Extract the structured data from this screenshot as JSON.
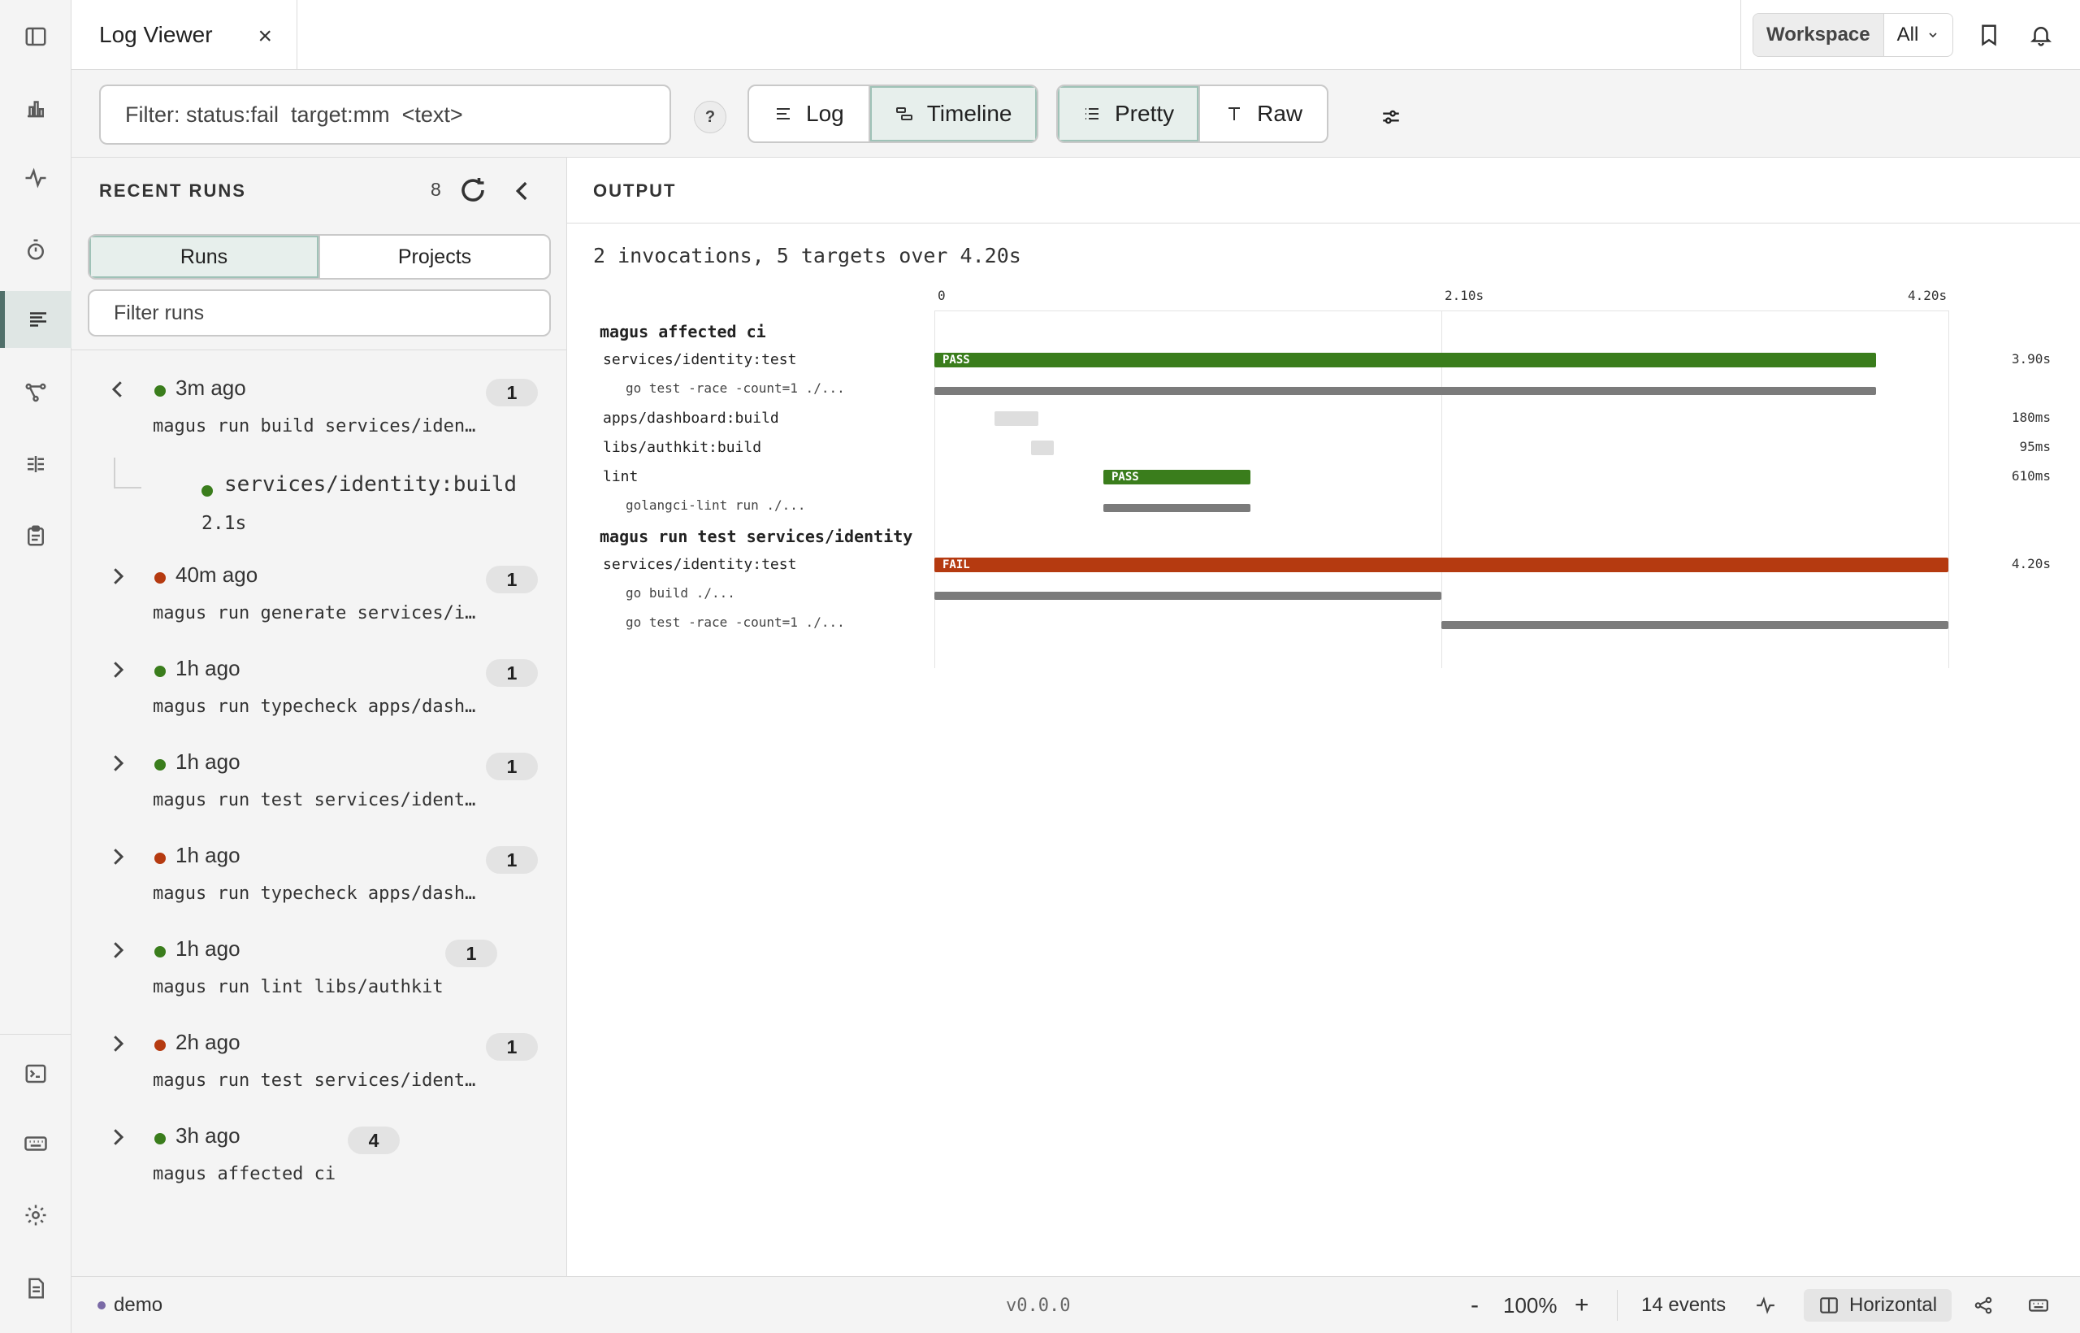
{
  "rail": {
    "icons": [
      "sidebar-toggle-icon",
      "bar-chart-icon",
      "pulse-icon",
      "stopwatch-icon",
      "log-lines-icon",
      "graph-icon",
      "split-columns-icon",
      "clipboard-icon",
      "terminal-icon",
      "keyboard-icon",
      "gear-icon",
      "document-icon"
    ],
    "active": "log-lines-icon"
  },
  "topbar": {
    "tab_title": "Log Viewer",
    "tab_close": "×",
    "workspace_label": "Workspace",
    "workspace_value": "All"
  },
  "toolbar": {
    "filter_value": "Filter: status:fail  target:mm  <text>",
    "help": "?",
    "view_modes": [
      {
        "label": "Log",
        "active": false
      },
      {
        "label": "Timeline",
        "active": true
      }
    ],
    "format_modes": [
      {
        "label": "Pretty",
        "active": true
      },
      {
        "label": "Raw",
        "active": false
      }
    ]
  },
  "sidebar": {
    "title": "RECENT RUNS",
    "count": "8",
    "tabs": [
      {
        "label": "Runs",
        "active": true
      },
      {
        "label": "Projects",
        "active": false
      }
    ],
    "filter_placeholder": "Filter runs",
    "runs": [
      {
        "time": "3m ago",
        "status": "pass",
        "cmd": "magus run build services/iden…",
        "badge": "1",
        "expanded": true,
        "children": [
          {
            "name": "services/identity:build",
            "duration": "2.1s",
            "status": "pass"
          }
        ]
      },
      {
        "time": "40m ago",
        "status": "fail",
        "cmd": "magus run generate services/i…",
        "badge": "1"
      },
      {
        "time": "1h ago",
        "status": "pass",
        "cmd": "magus run typecheck apps/dash…",
        "badge": "1"
      },
      {
        "time": "1h ago",
        "status": "pass",
        "cmd": "magus run test services/ident…",
        "badge": "1"
      },
      {
        "time": "1h ago",
        "status": "fail",
        "cmd": "magus run typecheck apps/dash…",
        "badge": "1"
      },
      {
        "time": "1h ago",
        "status": "pass",
        "cmd": "magus run lint libs/authkit",
        "badge": "1"
      },
      {
        "time": "2h ago",
        "status": "fail",
        "cmd": "magus run test services/ident…",
        "badge": "1"
      },
      {
        "time": "3h ago",
        "status": "pass",
        "cmd": "magus affected ci",
        "badge": "4"
      }
    ]
  },
  "output": {
    "title": "OUTPUT",
    "summary": "2 invocations, 5 targets over 4.20s",
    "axis": {
      "min": 0,
      "max": 4.2,
      "ticks": [
        {
          "v": 0,
          "label": "0"
        },
        {
          "v": 2.1,
          "label": "2.10s"
        },
        {
          "v": 4.2,
          "label": "4.20s"
        }
      ]
    },
    "rows": [
      {
        "kind": "group",
        "label": "magus affected ci"
      },
      {
        "kind": "target",
        "label": "services/identity:test",
        "start": 0,
        "end": 3.9,
        "status": "pass",
        "bar_text": "PASS",
        "duration": "3.90s"
      },
      {
        "kind": "cmd",
        "label": "go test -race -count=1 ./...",
        "start": 0,
        "end": 3.9
      },
      {
        "kind": "target",
        "label": "apps/dashboard:build",
        "start": 0.25,
        "end": 0.43,
        "status": "cached",
        "bar_text": "",
        "duration": "180ms"
      },
      {
        "kind": "target",
        "label": "libs/authkit:build",
        "start": 0.4,
        "end": 0.495,
        "status": "cached",
        "bar_text": "",
        "duration": "95ms"
      },
      {
        "kind": "target",
        "label": "lint",
        "start": 0.7,
        "end": 1.31,
        "status": "pass",
        "bar_text": "PASS",
        "duration": "610ms"
      },
      {
        "kind": "cmd",
        "label": "golangci-lint run ./...",
        "start": 0.7,
        "end": 1.31
      },
      {
        "kind": "group",
        "label": "magus run test services/identity"
      },
      {
        "kind": "target",
        "label": "services/identity:test",
        "start": 0,
        "end": 4.2,
        "status": "fail",
        "bar_text": "FAIL",
        "duration": "4.20s"
      },
      {
        "kind": "cmd",
        "label": "go build ./...",
        "start": 0,
        "end": 2.1
      },
      {
        "kind": "cmd",
        "label": "go test -race -count=1 ./...",
        "start": 2.1,
        "end": 4.2
      }
    ]
  },
  "statusbar": {
    "env": "demo",
    "version": "v0.0.0",
    "zoom_out": "-",
    "zoom": "100%",
    "zoom_in": "+",
    "events": "14 events",
    "layout": "Horizontal"
  },
  "colors": {
    "pass": "#3a7d1c",
    "fail": "#b53a10",
    "cached": "#dedede",
    "cmd": "#7b7b7b",
    "accent": "#51706a",
    "env_dot": "#7a6aa6"
  }
}
